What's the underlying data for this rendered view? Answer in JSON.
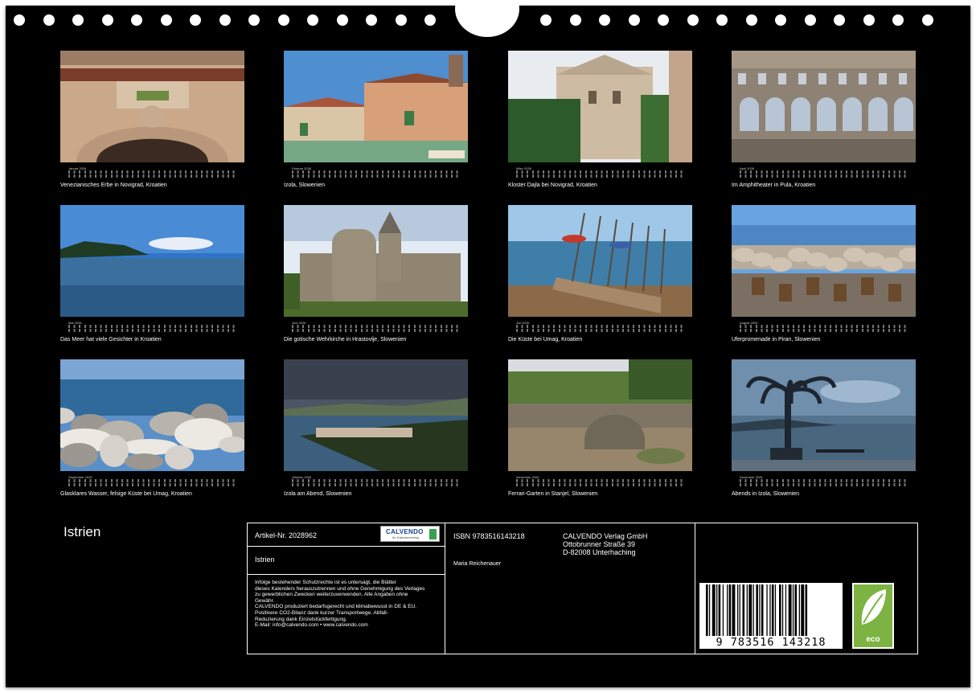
{
  "calendar": {
    "title": "Istrien"
  },
  "months": [
    {
      "label": "Januar 2026",
      "caption": "Venezianisches Erbe in Novigrad, Kroatien",
      "scene": "portal"
    },
    {
      "label": "Februar 2026",
      "caption": "Izola, Slowenien",
      "scene": "houses"
    },
    {
      "label": "März 2026",
      "caption": "Kloster Dajla bei Novigrad, Kroatien",
      "scene": "monastery"
    },
    {
      "label": "April 2026",
      "caption": "Im Amphitheater in Pula, Kroatien",
      "scene": "arena"
    },
    {
      "label": "Mai 2026",
      "caption": "Das Meer hat viele Gesichter in Kroatien",
      "scene": "sea"
    },
    {
      "label": "Juni 2026",
      "caption": "Die gotische Wehrkirche in Hrastovlje, Slowenien",
      "scene": "church"
    },
    {
      "label": "Juli 2026",
      "caption": "Die Küste bei Umag, Kroatien",
      "scene": "pier"
    },
    {
      "label": "August 2026",
      "caption": "Uferpromenade in Piran, Slowenien",
      "scene": "promenade"
    },
    {
      "label": "September 2026",
      "caption": "Glasklares Wasser, felsige Küste bei Umag, Kroatien",
      "scene": "rocks"
    },
    {
      "label": "Oktober 2026",
      "caption": "Izola am Abend, Slowenien",
      "scene": "bay"
    },
    {
      "label": "November 2026",
      "caption": "Ferrari-Garten in Stanjel, Slowenien",
      "scene": "garden"
    },
    {
      "label": "Dezember 2026",
      "caption": "Abends in Izola, Slowenien",
      "scene": "palm"
    }
  ],
  "imprint": {
    "article": "Artikel-Nr. 2028962",
    "brand": "CALVENDO",
    "brand_sub": "Ihr Kalenderverlag",
    "title": "Istrien",
    "legal": [
      "Infolge bestehender Schutzrechte ist es untersagt, die Blätter",
      "dieses Kalenders herauszutrennen und ohne Genehmigung des Verlages",
      "zu gewerblichen Zwecken weiterzuverwenden. Alle Angaben ohne",
      "Gewähr.",
      "CALVENDO produziert bedarfsgerecht und klimabewusst in DE & EU.",
      "Positivere CO2-Bilanz dank kurzer Transportwege. Abfall-",
      "Reduzierung dank Einzelstückfertigung.",
      "E-Mail: info@calvendo.com • www.calvendo.com"
    ],
    "isbn": "ISBN 9783516143218",
    "author": "Maria Reichenauer",
    "publisher": [
      "CALVENDO Verlag GmbH",
      "Ottobrunner Straße 39",
      "D-82008 Unterhaching"
    ],
    "barcode_digits": "9 783516 143218",
    "eco_label": "eco"
  }
}
